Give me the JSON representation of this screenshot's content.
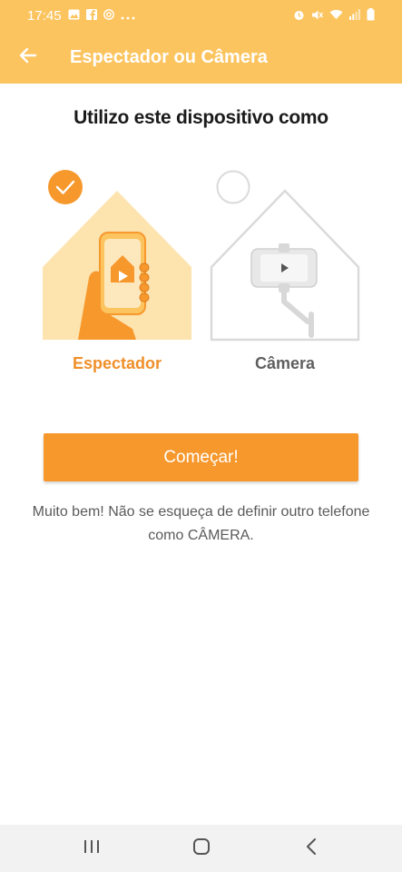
{
  "status_bar": {
    "time": "17:45",
    "left_icons": [
      "gallery-icon",
      "facebook-icon",
      "instagram-icon",
      "more-icon"
    ],
    "right_icons": [
      "alarm-icon",
      "mute-icon",
      "wifi-icon",
      "signal-icon",
      "battery-icon"
    ]
  },
  "app_bar": {
    "title": "Espectador ou Câmera",
    "back_icon": "arrow-left-icon"
  },
  "main": {
    "heading": "Utilizo este dispositivo como",
    "options": [
      {
        "label": "Espectador",
        "selected": true
      },
      {
        "label": "Câmera",
        "selected": false
      }
    ],
    "start_button": "Começar!",
    "hint": "Muito bem! Não se esqueça de definir outro telefone como CÂMERA."
  },
  "nav_bar": {
    "icons": [
      "recent-apps-icon",
      "home-icon",
      "back-icon"
    ]
  },
  "colors": {
    "accent": "#fcc45f",
    "button": "#f7982d",
    "selected_label": "#ef8f2a"
  }
}
